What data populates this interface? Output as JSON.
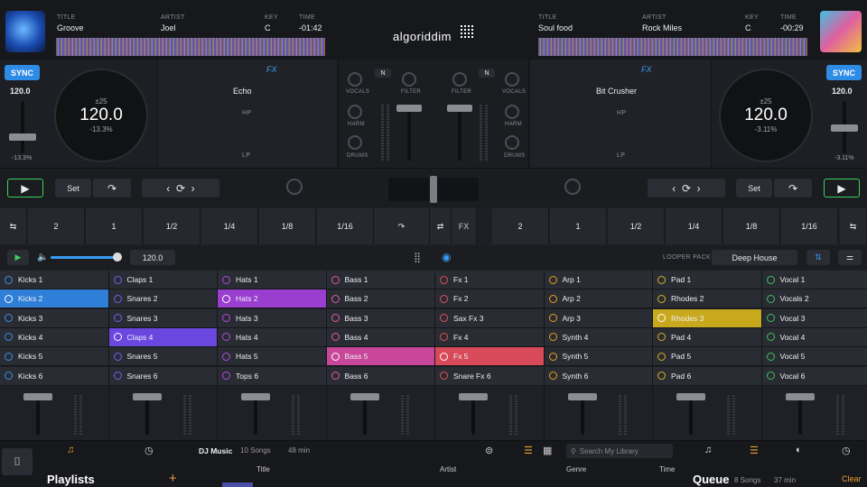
{
  "deck_left": {
    "title_label": "TITLE",
    "title": "Groove",
    "artist_label": "ARTIST",
    "artist": "Joel",
    "key_label": "KEY",
    "key": "C",
    "time_label": "TIME",
    "time": "-01:42",
    "sync": "SYNC",
    "bpm": "120.0",
    "pitch_range": "±25",
    "platter_bpm": "120.0",
    "pitch": "-13.3%",
    "pitch_small": "-13.3%",
    "fx_name": "Echo",
    "fx_label": "FX",
    "hp": "HP",
    "lp": "LP",
    "set": "Set"
  },
  "deck_right": {
    "title_label": "TITLE",
    "title": "Soul food",
    "artist_label": "ARTIST",
    "artist": "Rock Miles",
    "key_label": "KEY",
    "key": "C",
    "time_label": "TIME",
    "time": "-00:29",
    "sync": "SYNC",
    "bpm": "120.0",
    "pitch_range": "±25",
    "platter_bpm": "120.0",
    "pitch": "-3.11%",
    "pitch_small": "-3.11%",
    "fx_name": "Bit Crusher",
    "fx_label": "FX",
    "hp": "HP",
    "lp": "LP",
    "set": "Set"
  },
  "logo": "algoriddim",
  "mixer": {
    "n": "N",
    "vocals": "VOCALS",
    "filter": "FILTER",
    "harm": "HARM",
    "drums": "DRUMS"
  },
  "loops_left": [
    "2",
    "1",
    "1/2",
    "1/4",
    "1/8",
    "1/16"
  ],
  "loops_right": [
    "2",
    "1",
    "1/2",
    "1/4",
    "1/8",
    "1/16"
  ],
  "looper": {
    "bpm": "120.0",
    "pack_label": "LOOPER PACK",
    "pack": "Deep House"
  },
  "grid": [
    {
      "color": "#3a8fe8",
      "items": [
        "Kicks 1",
        "Kicks 2",
        "Kicks 3",
        "Kicks 4",
        "Kicks 5",
        "Kicks 6"
      ],
      "active": 1
    },
    {
      "color": "#7a5cf0",
      "items": [
        "Claps 1",
        "Snares 2",
        "Snares 3",
        "Claps 4",
        "Snares 5",
        "Snares 6"
      ],
      "active": 3
    },
    {
      "color": "#b44ae0",
      "items": [
        "Hats 1",
        "Hats 2",
        "Hats 3",
        "Hats 4",
        "Hats 5",
        "Tops 6"
      ],
      "active": 1
    },
    {
      "color": "#e05aa8",
      "items": [
        "Bass 1",
        "Bass 2",
        "Bass 3",
        "Bass 4",
        "Bass 5",
        "Bass 6"
      ],
      "active": 4
    },
    {
      "color": "#e25060",
      "items": [
        "Fx 1",
        "Fx 2",
        "Sax Fx 3",
        "Fx 4",
        "Fx 5",
        "Snare Fx 6"
      ],
      "active": 4
    },
    {
      "color": "#e8a020",
      "items": [
        "Arp 1",
        "Arp 2",
        "Arp 3",
        "Synth 4",
        "Synth 5",
        "Synth 6"
      ],
      "active": -1
    },
    {
      "color": "#d8b020",
      "items": [
        "Pad 1",
        "Rhodes 2",
        "Rhodes 3",
        "Pad 4",
        "Pad 5",
        "Pad 6"
      ],
      "active": 2
    },
    {
      "color": "#40c060",
      "items": [
        "Vocal 1",
        "Vocals 2",
        "Vocal 3",
        "Vocal 4",
        "Vocal 5",
        "Vocal 6"
      ],
      "active": -1
    }
  ],
  "grid_active_colors": [
    "#2f7fd8",
    "#6a48e0",
    "#9a3ed0",
    "#c8479a",
    "#d84a5a",
    "#d8a020",
    "#c8a81c",
    "#3ab058"
  ],
  "library": {
    "source": "DJ Music",
    "songs": "10 Songs",
    "duration": "48 min",
    "search_placeholder": "Search My Library",
    "col_title": "Title",
    "col_artist": "Artist",
    "col_genre": "Genre",
    "col_time": "Time",
    "playlists": "Playlists",
    "add": "+",
    "queue": "Queue",
    "queue_songs": "8 Songs",
    "queue_duration": "37 min",
    "clear": "Clear"
  }
}
